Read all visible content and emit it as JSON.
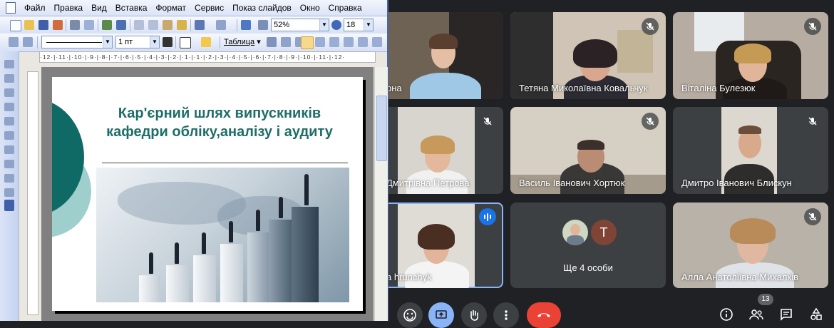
{
  "word": {
    "menu": [
      "Файл",
      "Правка",
      "Вид",
      "Вставка",
      "Формат",
      "Сервис",
      "Показ слайдов",
      "Окно",
      "Справка"
    ],
    "zoom": "52%",
    "font_size": "18",
    "line_weight": "1 пт",
    "table_menu": "Таблица",
    "ruler_text": "·12·|·11·|·10·|·9·|·8·|·7·|·6·|·5·|·4·|·3·|·2·|·1·|·1·|·2·|·3·|·4·|·5·|·6·|·7·|·8·|·9·|·10·|·11·|·12·",
    "slide": {
      "title_line1": "Кар'єрний шлях випускників",
      "title_line2": "кафедри обліку,аналізу і аудиту"
    }
  },
  "meet": {
    "tiles": [
      {
        "name": "рна",
        "muted": false
      },
      {
        "name": "Тетяна Миколаївна Ковальчук",
        "muted": true
      },
      {
        "name": "Віталіна Булезюк",
        "muted": true
      },
      {
        "name": "Дмитрівна Петрова",
        "muted": true
      },
      {
        "name": "Василь Іванович Хортюк",
        "muted": true
      },
      {
        "name": "Дмитро Іванович Блискун",
        "muted": true
      },
      {
        "name": "a hrunchyk",
        "speaking": true
      },
      {
        "name": "Ще 4 особи",
        "avatar_letter": "Т"
      },
      {
        "name": "Алла Анатоліївна Михалків",
        "muted": true
      }
    ],
    "participants_count": "13",
    "colors": {
      "background": "#202124",
      "tile": "#3c4043",
      "end_call": "#ea4335",
      "active": "#8ab4f8",
      "speaking_badge": "#1a73e8"
    }
  }
}
